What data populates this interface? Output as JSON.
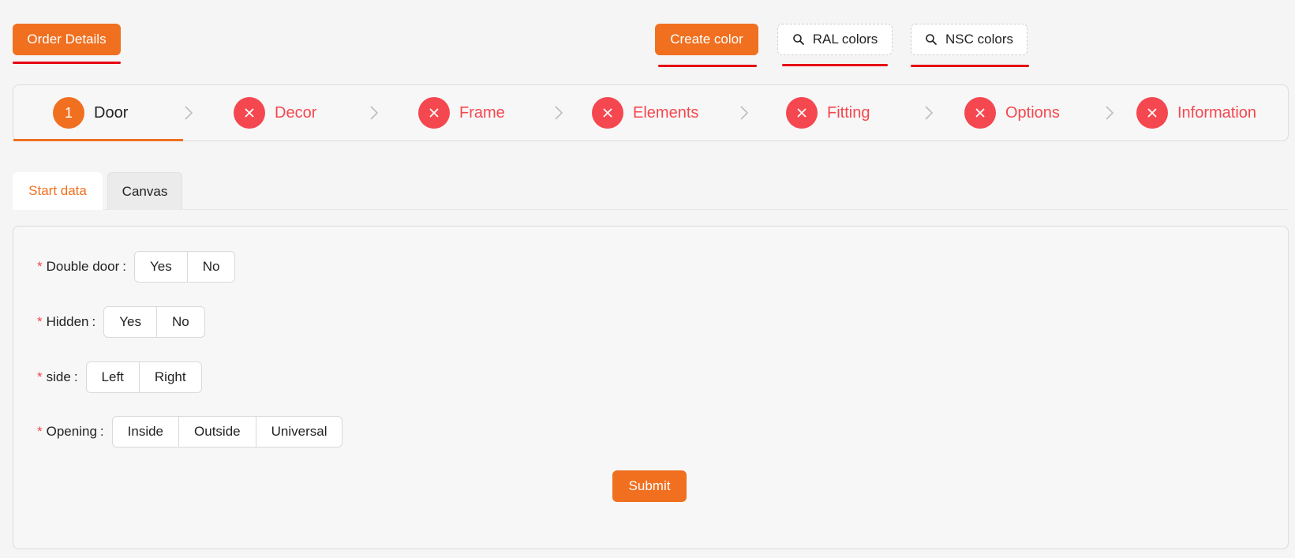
{
  "toolbar": {
    "order_details": "Order Details",
    "create_color": "Create color",
    "ral_colors": "RAL colors",
    "nsc_colors": "NSC colors"
  },
  "colors": {
    "accent": "#f07020",
    "error": "#f5474f",
    "underline": "#e60012"
  },
  "steps": [
    {
      "number": "1",
      "label": "Door",
      "status": "active"
    },
    {
      "label": "Decor",
      "status": "error",
      "icon": "close-icon"
    },
    {
      "label": "Frame",
      "status": "error",
      "icon": "close-icon"
    },
    {
      "label": "Elements",
      "status": "error",
      "icon": "close-icon"
    },
    {
      "label": "Fitting",
      "status": "error",
      "icon": "close-icon"
    },
    {
      "label": "Options",
      "status": "error",
      "icon": "close-icon"
    },
    {
      "label": "Information",
      "status": "error",
      "icon": "close-icon"
    }
  ],
  "tabs": [
    {
      "label": "Start data",
      "active": true
    },
    {
      "label": "Canvas",
      "active": false
    }
  ],
  "form": {
    "required_mark": "*",
    "colon": ":",
    "double_door": {
      "label": "Double door",
      "options": [
        "Yes",
        "No"
      ]
    },
    "hidden": {
      "label": "Hidden",
      "options": [
        "Yes",
        "No"
      ]
    },
    "side": {
      "label": "side",
      "options": [
        "Left",
        "Right"
      ]
    },
    "opening": {
      "label": "Opening",
      "options": [
        "Inside",
        "Outside",
        "Universal"
      ]
    },
    "submit_label": "Submit"
  }
}
